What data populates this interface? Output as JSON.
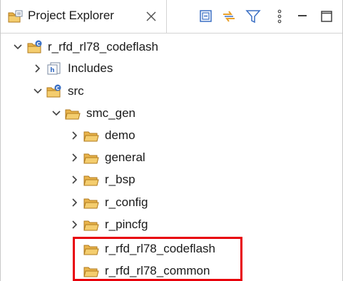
{
  "view": {
    "title": "Project Explorer",
    "icon": "project-explorer-icon"
  },
  "toolbar": {
    "buttons": [
      {
        "name": "collapse-all-icon"
      },
      {
        "name": "link-with-editor-icon"
      },
      {
        "name": "filter-icon"
      },
      {
        "name": "view-menu-icon"
      },
      {
        "name": "minimize-icon"
      },
      {
        "name": "maximize-icon"
      }
    ]
  },
  "tree": {
    "project": {
      "label": "r_rfd_rl78_codeflash",
      "expanded": true
    },
    "includes": {
      "label": "Includes",
      "expanded": false
    },
    "src": {
      "label": "src",
      "expanded": true
    },
    "smc_gen": {
      "label": "smc_gen",
      "expanded": true
    },
    "children": [
      {
        "label": "demo",
        "expanded": false
      },
      {
        "label": "general",
        "expanded": false
      },
      {
        "label": "r_bsp",
        "expanded": false
      },
      {
        "label": "r_config",
        "expanded": false
      },
      {
        "label": "r_pincfg",
        "expanded": false
      },
      {
        "label": "r_rfd_rl78_codeflash",
        "expanded": false
      },
      {
        "label": "r_rfd_rl78_common",
        "expanded": false
      }
    ]
  },
  "colors": {
    "highlight": "#e8000b",
    "folder": "#e9b44c",
    "source_badge": "#3a6fc4"
  }
}
